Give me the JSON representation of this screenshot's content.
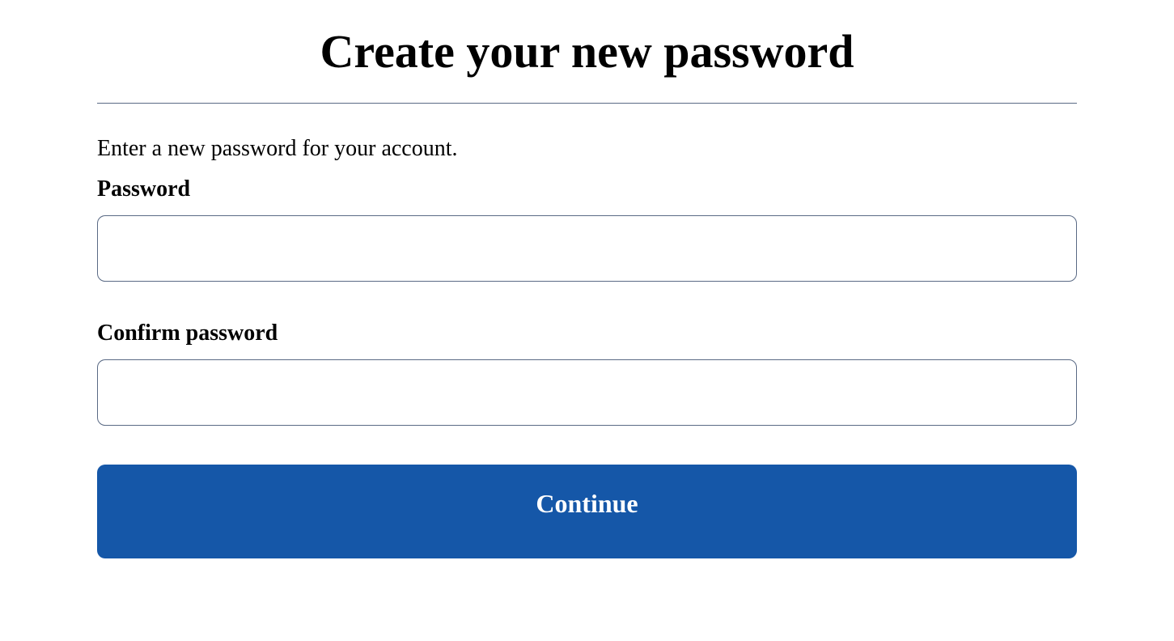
{
  "title": "Create your new password",
  "instruction": "Enter a new password for your account.",
  "fields": {
    "password": {
      "label": "Password",
      "value": ""
    },
    "confirm": {
      "label": "Confirm password",
      "value": ""
    }
  },
  "button": {
    "continue": "Continue"
  }
}
